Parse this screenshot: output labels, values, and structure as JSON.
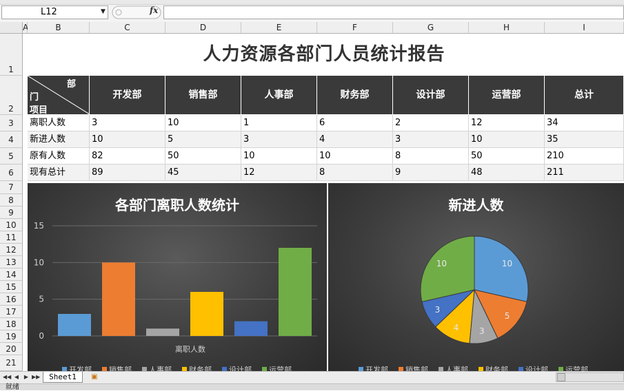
{
  "formula_bar": {
    "name_box": "L12",
    "fx": "fx",
    "formula": ""
  },
  "columns": [
    "A",
    "B",
    "C",
    "D",
    "E",
    "F",
    "G",
    "H",
    "I"
  ],
  "rows": [
    "1",
    "2",
    "3",
    "4",
    "5",
    "6",
    "7",
    "8",
    "9",
    "10",
    "11",
    "12",
    "13",
    "14",
    "15",
    "16",
    "17",
    "18",
    "19",
    "20",
    "21"
  ],
  "sheet": {
    "title": "人力资源各部门人员统计报告",
    "corner_top": "部",
    "corner_mid": "门",
    "corner_bottom": "项目",
    "headers": [
      "开发部",
      "销售部",
      "人事部",
      "财务部",
      "设计部",
      "运营部",
      "总计"
    ],
    "table": [
      {
        "label": "离职人数",
        "values": [
          "3",
          "10",
          "1",
          "6",
          "2",
          "12",
          "34"
        ]
      },
      {
        "label": "新进人数",
        "values": [
          "10",
          "5",
          "3",
          "4",
          "3",
          "10",
          "35"
        ]
      },
      {
        "label": "原有人数",
        "values": [
          "82",
          "50",
          "10",
          "10",
          "8",
          "50",
          "210"
        ]
      },
      {
        "label": "现有总计",
        "values": [
          "89",
          "45",
          "12",
          "8",
          "9",
          "48",
          "211"
        ]
      }
    ]
  },
  "colors": {
    "开发部": "#5b9bd5",
    "销售部": "#ed7d31",
    "人事部": "#a5a5a5",
    "财务部": "#ffc000",
    "设计部": "#4472c4",
    "运营部": "#70ad47"
  },
  "chart_data": [
    {
      "type": "bar",
      "title": "各部门离职人数统计",
      "xlabel": "离职人数",
      "categories": [
        "开发部",
        "销售部",
        "人事部",
        "财务部",
        "设计部",
        "运营部"
      ],
      "values": [
        3,
        10,
        1,
        6,
        2,
        12
      ],
      "ylim": [
        0,
        15
      ],
      "yticks": [
        "0",
        "5",
        "10",
        "15"
      ],
      "grid": true,
      "legend": "bottom"
    },
    {
      "type": "pie",
      "title": "新进人数",
      "categories": [
        "开发部",
        "销售部",
        "人事部",
        "财务部",
        "设计部",
        "运营部"
      ],
      "values": [
        10,
        5,
        3,
        4,
        3,
        10
      ],
      "legend": "bottom"
    }
  ],
  "tabs": {
    "sheet1": "Sheet1"
  },
  "status": {
    "text": "就绪"
  }
}
